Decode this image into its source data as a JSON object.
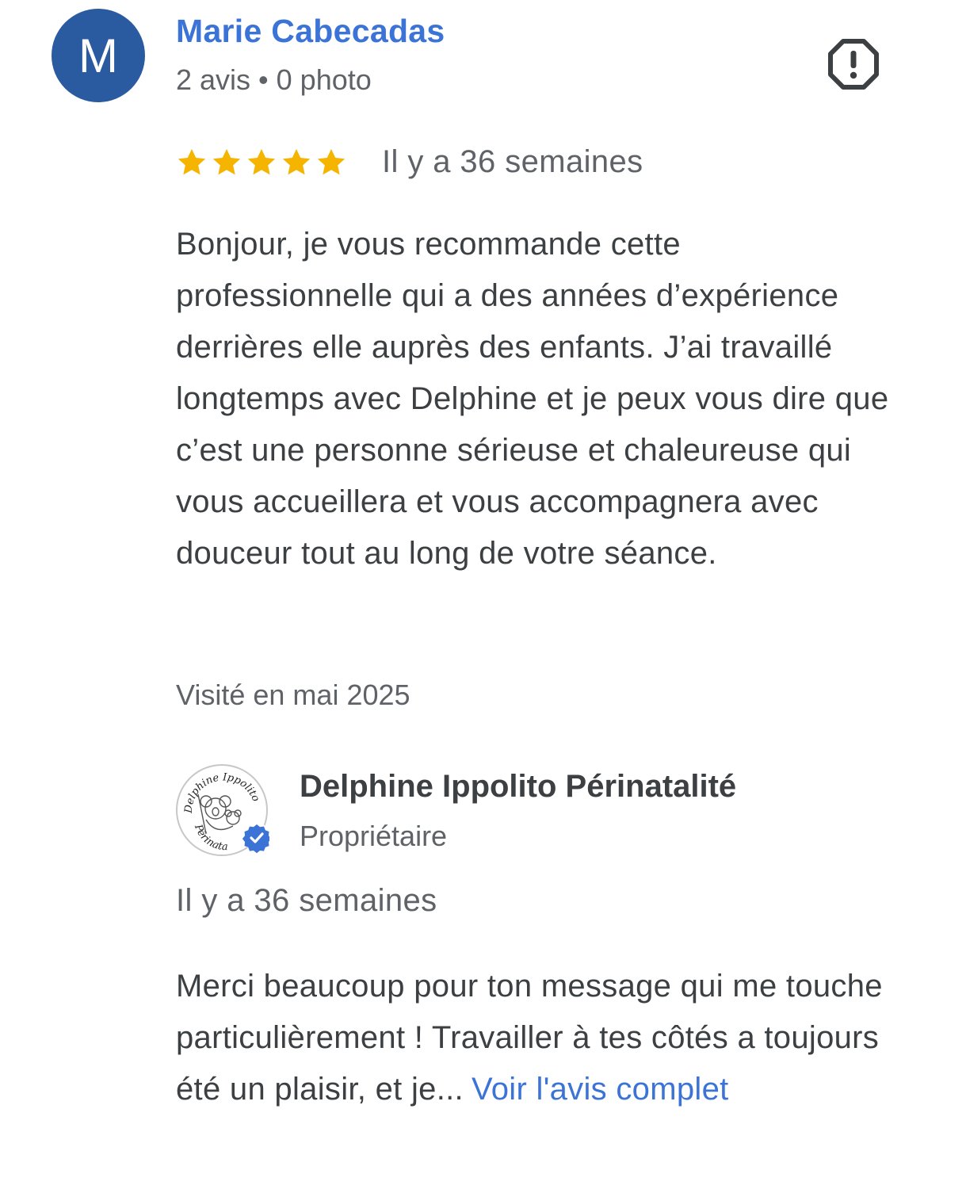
{
  "review": {
    "author": {
      "initial": "M",
      "avatar_color": "#2a5aa0",
      "name": "Marie Cabecadas",
      "meta": "2 avis • 0 photo"
    },
    "report_icon": "report-flag-icon",
    "rating": 5,
    "rating_max": 5,
    "star_color": "#f4b400",
    "date": "Il y a 36 semaines",
    "text": "Bonjour, je vous recommande cette professionnelle qui a des années d’expérience derrières elle auprès des enfants. J’ai travaillé longtemps avec Delphine et je peux vous dire que c’est une personne sérieuse et chaleureuse qui vous accueillera et vous accompagnera avec douceur tout au long de votre séance.",
    "visited": "Visité en mai 2025"
  },
  "owner_reply": {
    "logo_text_top": "Delphine Ippolito",
    "logo_text_bottom": "Périnata",
    "verified_icon": "verified-badge-icon",
    "name": "Delphine Ippolito Périnatalité",
    "role": "Propriétaire",
    "date": "Il y a 36 semaines",
    "text": "Merci beaucoup pour ton message qui me touche particulièrement ! Travailler à tes côtés a toujours été un plaisir, et je...",
    "more_label": "Voir l'avis complet",
    "link_color": "#3b73d6"
  }
}
